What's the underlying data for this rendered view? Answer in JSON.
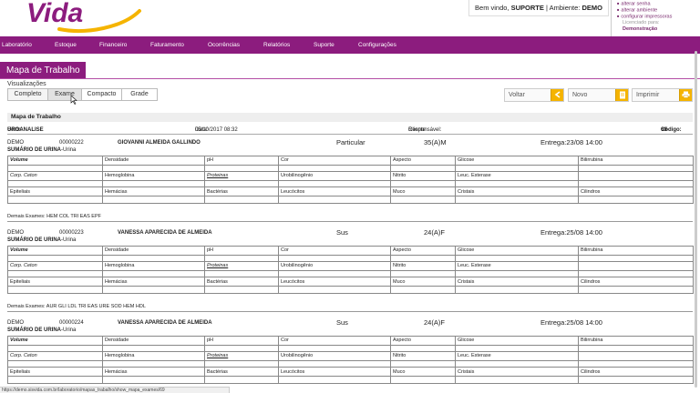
{
  "header": {
    "logo_text": "Vida",
    "welcome_prefix": "Bem vindo,",
    "user": "SUPORTE",
    "env_label": "| Ambiente:",
    "env": "DEMO",
    "menu": [
      "alterar senha",
      "alterar ambiente",
      "configurar impressoras"
    ],
    "licensed_label": "Licenciado para:",
    "licensed_org": "Demonstração"
  },
  "nav": [
    "Laboratório",
    "Estoque",
    "Financeiro",
    "Faturamento",
    "Ocorrências",
    "Relatórios",
    "Suporte",
    "Configurações"
  ],
  "page_title": "Mapa de Trabalho",
  "views": {
    "label": "Visualizações",
    "options": [
      "Completo",
      "Exame",
      "Compacto",
      "Grade"
    ],
    "selected": "Exame"
  },
  "buttons": {
    "voltar": "Voltar",
    "novo": "Novo",
    "imprimir": "Imprimir"
  },
  "map": {
    "title": "Mapa de Trabalho",
    "setor_label": "Setor:",
    "setor": "UROANALISE",
    "data_label": "Data:",
    "data": "05/10/2017 08:32",
    "resp_label": "Responsável:",
    "resp": "Cliente",
    "codigo_label": "Código:",
    "codigo": "69"
  },
  "grid_labels": [
    [
      "Volume",
      "Densidade",
      "pH",
      "Cor",
      "Aspecto",
      "Glicose",
      "Bilirrubina"
    ],
    [
      "Corp. Ceton",
      "Hemoglobina",
      "Proteinas",
      "Urobilinogênio",
      "Nitrito",
      "Leuc. Esterase",
      ""
    ],
    [
      "Epiteliais",
      "Hemácias",
      "Bactérias",
      "Leucócitos",
      "Muco",
      "Cristais",
      "Cilindros"
    ]
  ],
  "patients": [
    {
      "origin": "DEMO",
      "code": "00000222",
      "name": "GIOVANNI ALMEIDA GALLINDO",
      "plan": "Particular",
      "age": "35(A)M",
      "delivery": "Entrega:23/08 14:00",
      "summary": "SUMÁRIO DE URINA",
      "material": "-Urina",
      "demais": "Demais Exames: HEM COL TRI EAS EPF"
    },
    {
      "origin": "DEMO",
      "code": "00000223",
      "name": "VANESSA APARECIDA DE ALMEIDA",
      "plan": "Sus",
      "age": "24(A)F",
      "delivery": "Entrega:25/08 14:00",
      "summary": "SUMÁRIO DE URINA",
      "material": "-Urina",
      "demais": "Demais Exames: AUR GLI LDL TRI EAS URE SOD HEM HDL"
    },
    {
      "origin": "DEMO",
      "code": "00000224",
      "name": "VANESSA APARECIDA DE ALMEIDA",
      "plan": "Sus",
      "age": "24(A)F",
      "delivery": "Entrega:25/08 14:00",
      "summary": "SUMÁRIO DE URINA",
      "material": "-Urina",
      "demais": ""
    }
  ],
  "status_url": "https://demo.sisvida.com.br/laboratorio/mapas_trabalho/show_mapa_exames/69",
  "colors": {
    "brand": "#8c1c7e",
    "accent": "#f5b400"
  }
}
